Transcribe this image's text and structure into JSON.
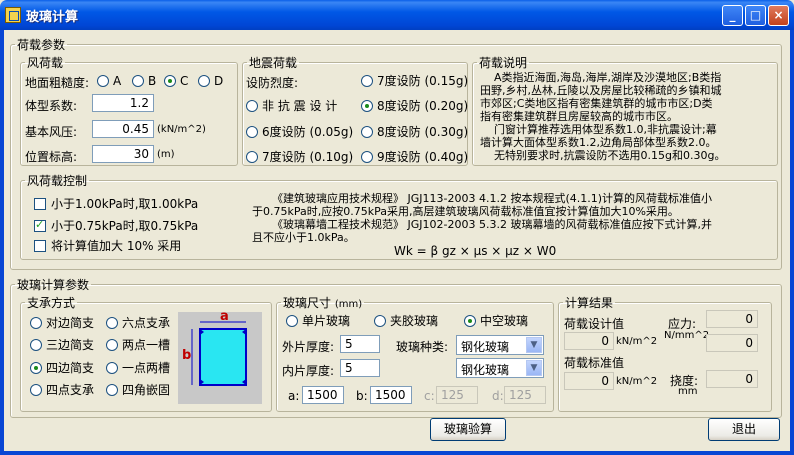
{
  "window": {
    "title": "玻璃计算",
    "min": "_",
    "max": "□",
    "close": "×"
  },
  "load": {
    "legend": "荷载参数",
    "wind": {
      "legend": "风荷载",
      "roughness_label": "地面粗糙度:",
      "roughness_options": [
        "A",
        "B",
        "C",
        "D"
      ],
      "shape_label": "体型系数:",
      "shape_value": "1.2",
      "pressure_label": "基本风压:",
      "pressure_value": "0.45",
      "pressure_unit": "(kN/m^2)",
      "height_label": "位置标高:",
      "height_value": "30",
      "height_unit": "(m)"
    },
    "seismic": {
      "legend": "地震荷载",
      "intensity_label": "设防烈度:",
      "none_label": "非 抗 震 设 计",
      "options": [
        "7度设防 (0.15g)",
        "8度设防 (0.20g)",
        "6度设防 (0.05g)",
        "8度设防 (0.30g)",
        "7度设防 (0.10g)",
        "9度设防 (0.40g)"
      ]
    },
    "note": {
      "legend": "荷载说明",
      "lines": [
        "A类指近海面,海岛,海岸,湖岸及沙漠地区;B类指",
        "田野,乡村,丛林,丘陵以及房屋比较稀疏的乡镇和城",
        "市郊区;C类地区指有密集建筑群的城市市区;D类",
        "指有密集建筑群且房屋较高的城市市区。",
        "门窗计算推荐选用体型系数1.0,非抗震设计;幕",
        "墙计算大面体型系数1.2,边角局部体型系数2.0。",
        "无特别要求时,抗震设防不选用0.15g和0.30g。"
      ]
    },
    "control": {
      "legend": "风荷载控制",
      "opt1": "小于1.00kPa时,取1.00kPa",
      "opt2": "小于0.75kPa时,取0.75kPa",
      "opt3": "将计算值加大 10% 采用",
      "text_lines": [
        "《建筑玻璃应用技术规程》 JGJ113-2003   4.1.2 按本规程式(4.1.1)计算的风荷载标准值小",
        "于0.75kPa时,应按0.75kPa采用,高层建筑玻璃风荷载标准值宜按计算值加大10%采用。",
        "《玻璃幕墙工程技术规范》 JGJ102-2003   5.3.2 玻璃幕墙的风荷载标准值应按下式计算,并",
        "且不应小于1.0kPa。"
      ],
      "formula": "Wk = β gz × μs × μz × W0"
    }
  },
  "glass": {
    "legend": "玻璃计算参数",
    "support": {
      "legend": "支承方式",
      "options": [
        "对边简支",
        "六点支承",
        "三边简支",
        "两点一槽",
        "四边简支",
        "一点两槽",
        "四点支承",
        "四角嵌固"
      ],
      "dim_a": "a",
      "dim_b": "b"
    },
    "size": {
      "legend": "玻璃尺寸",
      "legend_unit": "(mm)",
      "types": [
        "单片玻璃",
        "夹胶玻璃",
        "中空玻璃"
      ],
      "outer_label": "外片厚度:",
      "outer_value": "5",
      "inner_label": "内片厚度:",
      "inner_value": "5",
      "kind_label": "玻璃种类:",
      "kind_outer": "钢化玻璃",
      "kind_inner": "钢化玻璃",
      "a_label": "a:",
      "a_value": "1500",
      "b_label": "b:",
      "b_value": "1500",
      "c_label": "c:",
      "c_value": "125",
      "d_label": "d:",
      "d_value": "125"
    },
    "result": {
      "legend": "计算结果",
      "design_label": "荷载设计值",
      "design_value": "0",
      "design_unit": "kN/m^2",
      "standard_label": "荷载标准值",
      "standard_value": "0",
      "standard_unit": "kN/m^2",
      "stress_label": "应力:",
      "stress_unit": "N/mm^2",
      "stress_value": "0",
      "stress_value2": "0",
      "defl_label": "挠度:",
      "defl_unit": "mm",
      "defl_value": "0"
    }
  },
  "buttons": {
    "check": "玻璃验算",
    "exit": "退出"
  }
}
